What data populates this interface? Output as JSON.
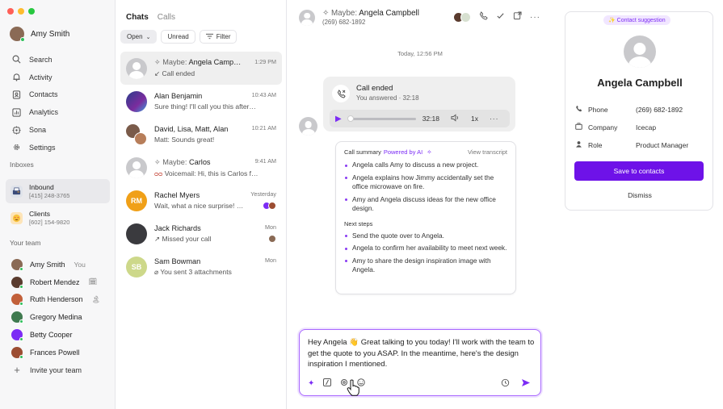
{
  "window": {
    "dot_colors": [
      "#ff5f57",
      "#febc2e",
      "#28c840"
    ]
  },
  "user": {
    "name": "Amy Smith"
  },
  "nav": [
    {
      "label": "Search",
      "icon": "search-icon",
      "glyph": "⌕"
    },
    {
      "label": "Activity",
      "icon": "bell-icon",
      "glyph": "🔔︎"
    },
    {
      "label": "Contacts",
      "icon": "contacts-icon",
      "glyph": "▤"
    },
    {
      "label": "Analytics",
      "icon": "analytics-icon",
      "glyph": "▦"
    },
    {
      "label": "Sona",
      "icon": "sona-icon",
      "glyph": "◈"
    },
    {
      "label": "Settings",
      "icon": "gear-icon",
      "glyph": "⚙"
    }
  ],
  "inboxes_label": "Inboxes",
  "inboxes": [
    {
      "name": "Inbound",
      "number": "[415] 248-3765",
      "emoji": "📠",
      "bg": "#dfe3ea"
    },
    {
      "name": "Clients",
      "number": "[602] 154-9820",
      "emoji": "😍",
      "bg": "#fde4b8"
    }
  ],
  "team_label": "Your team",
  "team": [
    {
      "name": "Amy Smith",
      "extra": "You",
      "color": "#8a6a55"
    },
    {
      "name": "Robert Mendez",
      "extra": "🗓",
      "color": "#5a3b2e"
    },
    {
      "name": "Ruth Henderson",
      "extra": "🏝",
      "color": "#c2603a"
    },
    {
      "name": "Gregory Medina",
      "extra": "",
      "color": "#3f7a4f"
    },
    {
      "name": "Betty Cooper",
      "extra": "",
      "color": "#7c2cf5"
    },
    {
      "name": "Frances Powell",
      "extra": "",
      "color": "#9c4d32"
    }
  ],
  "invite_label": "Invite your team",
  "chats": {
    "tabs": [
      "Chats",
      "Calls"
    ],
    "filters": [
      "Open",
      "Unread",
      "Filter"
    ],
    "items": [
      {
        "maybe": "Maybe:",
        "name": "Angela Campbell",
        "preview": "Call ended",
        "time": "1:29 PM",
        "avatar": "gray"
      },
      {
        "maybe": "",
        "name": "Alan Benjamin",
        "preview": "Sure thing! I'll call you this afternoon",
        "time": "10:43 AM",
        "avatar": "#3b62c9"
      },
      {
        "maybe": "",
        "name": "David, Lisa, Matt, Alan",
        "preview": "Matt: Sounds great!",
        "time": "10:21 AM",
        "avatar": "#7a5b4a"
      },
      {
        "maybe": "Maybe:",
        "name": "Carlos",
        "preview": "Voicemail: Hi, this is Carlos from",
        "time": "9:41 AM",
        "avatar": "gray"
      },
      {
        "maybe": "",
        "name": "Rachel Myers",
        "preview": "Wait, what a nice surprise! Please",
        "time": "Yesterday",
        "avatar": "#f0a018",
        "initials": "RM"
      },
      {
        "maybe": "",
        "name": "Jack Richards",
        "preview": "Missed your call",
        "time": "Mon",
        "avatar": "#3a3a3e"
      },
      {
        "maybe": "",
        "name": "Sam Bowman",
        "preview": "You sent 3 attachments",
        "time": "Mon",
        "avatar": "#cdd88a",
        "initials": "SB"
      }
    ]
  },
  "conversation": {
    "maybe": "Maybe:",
    "name": "Angela Campbell",
    "phone": "(269) 682-1892",
    "day": "Today, 12:56 PM",
    "call_title": "Call ended",
    "call_sub": "You answered · 32:18",
    "duration": "32:18",
    "speed": "1x",
    "playback_progress": 0.0,
    "summary_label": "Call summary",
    "powered": "Powered by AI",
    "view_transcript": "View transcript",
    "summary": [
      "Angela calls Amy to discuss a new project.",
      "Angela explains how Jimmy accidentally set the office microwave on fire.",
      "Amy and Angela discuss ideas for the new office design."
    ],
    "next_steps_label": "Next steps",
    "next_steps": [
      "Send the quote over to Angela.",
      "Angela to confirm her availability to meet next week.",
      "Amy to share the design inspiration image with Angela."
    ],
    "draft": "Hey Angela 👋 Great talking to you today! I'll work with the team to get the quote to you ASAP. In the meantime, here's the design inspiration I mentioned."
  },
  "contact": {
    "badge": "✨ Contact suggestion",
    "name": "Angela Campbell",
    "fields": [
      {
        "label": "Phone",
        "value": "(269) 682-1892",
        "icon": "phone-icon",
        "glyph": "✆"
      },
      {
        "label": "Company",
        "value": "Icecap",
        "icon": "building-icon",
        "glyph": "▣"
      },
      {
        "label": "Role",
        "value": "Product Manager",
        "icon": "person-icon",
        "glyph": "👤︎"
      }
    ],
    "save_label": "Save to contacts",
    "dismiss_label": "Dismiss"
  },
  "accent_color": "#6e12e8"
}
